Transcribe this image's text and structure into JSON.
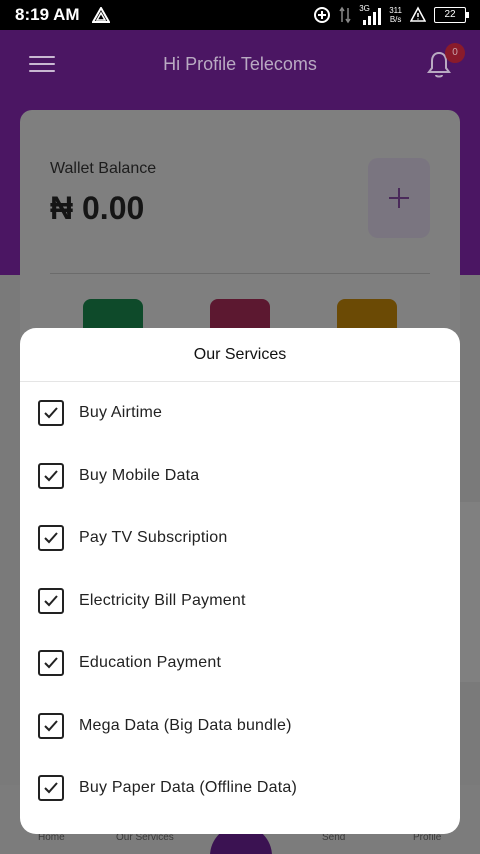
{
  "status_bar": {
    "time": "8:19 AM",
    "network": "3G",
    "speed_value": "311",
    "speed_unit": "B/s",
    "battery": "22",
    "icons": [
      "alert-triangle-icon",
      "data-saver-icon",
      "sync-arrows-icon",
      "signal-bars-icon",
      "warning-icon",
      "battery-icon"
    ]
  },
  "header": {
    "title": "Hi Profile Telecoms",
    "notification_count": "0"
  },
  "wallet": {
    "label": "Wallet Balance",
    "amount": "₦ 0.00"
  },
  "bottom_nav": {
    "items": [
      "Home",
      "Our Services",
      "Send",
      "Profile"
    ]
  },
  "modal": {
    "title": "Our Services",
    "items": [
      {
        "label": "Buy Airtime",
        "checked": true
      },
      {
        "label": "Buy Mobile Data",
        "checked": true
      },
      {
        "label": "Pay TV Subscription",
        "checked": true
      },
      {
        "label": "Electricity Bill Payment",
        "checked": true
      },
      {
        "label": "Education Payment",
        "checked": true
      },
      {
        "label": "Mega Data (Big Data bundle)",
        "checked": true
      },
      {
        "label": "Buy Paper Data (Offline Data)",
        "checked": true
      }
    ]
  },
  "colors": {
    "brand_purple": "#6a1b9a",
    "status_bar": "#000000",
    "modal_bg": "#ffffff"
  }
}
